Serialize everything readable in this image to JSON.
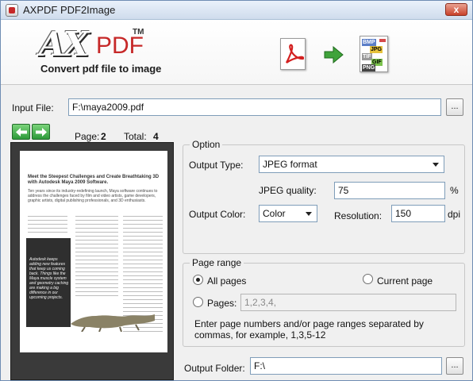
{
  "window": {
    "title": "AXPDF PDF2Image",
    "close_label": "x"
  },
  "header": {
    "logo_ax": "AX",
    "logo_pdf": "PDF",
    "logo_tm": "TM",
    "tagline": "Convert pdf file to image",
    "format_badges": [
      "BMP",
      "JPG",
      "TIF",
      "GIF",
      "PNG"
    ]
  },
  "input": {
    "label": "Input File:",
    "value": "F:\\maya2009.pdf",
    "browse_label": "..."
  },
  "pager": {
    "page_label": "Page:",
    "page_value": "2",
    "total_label": "Total:",
    "total_value": "4"
  },
  "preview": {
    "heading": "Meet the Steepest Challenges and Create Breathtaking 3D with Autodesk Maya 2009 Software.",
    "intro": "Ten years since its industry-redefining launch, Maya software continues to address the challenges faced by film and video artists, game developers, graphic artists, digital publishing professionals, and 3D enthusiasts.",
    "quote": "Autodesk keeps adding new features that keep us coming back. Things like the Maya muscle system and geometry caching are making a big difference in our upcoming projects."
  },
  "option": {
    "title": "Option",
    "output_type_label": "Output Type:",
    "output_type_value": "JPEG format",
    "jpeg_quality_label": "JPEG quality:",
    "jpeg_quality_value": "75",
    "jpeg_quality_unit": "%",
    "output_color_label": "Output Color:",
    "output_color_value": "Color",
    "resolution_label": "Resolution:",
    "resolution_value": "150",
    "resolution_unit": "dpi"
  },
  "page_range": {
    "title": "Page range",
    "all_pages_label": "All pages",
    "current_page_label": "Current page",
    "pages_label": "Pages:",
    "pages_placeholder": "1,2,3,4,",
    "hint": "Enter page numbers and/or page ranges separated by commas, for example, 1,3,5-12"
  },
  "output": {
    "folder_label": "Output Folder:",
    "folder_value": "F:\\",
    "browse_label": "..."
  }
}
